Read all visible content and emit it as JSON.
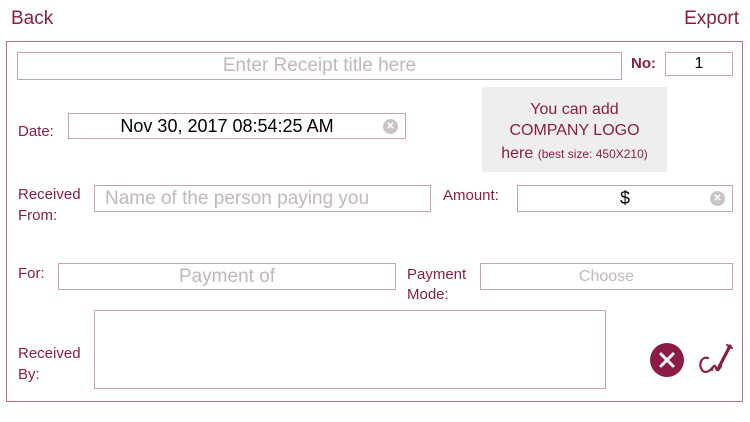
{
  "nav": {
    "back": "Back",
    "export": "Export"
  },
  "receipt": {
    "title_placeholder": "Enter Receipt title here",
    "no_label": "No:",
    "no_value": "1",
    "date_label": "Date:",
    "date_value": "Nov 30, 2017 08:54:25 AM",
    "logo": {
      "line1": "You can add",
      "line2": "COMPANY LOGO",
      "line3": "here",
      "line3_note": "(best size: 450X210)"
    },
    "received_from_label_1": "Received",
    "received_from_label_2": "From:",
    "received_from_placeholder": "Name of the person paying you",
    "amount_label": "Amount:",
    "amount_value": "$",
    "for_label": "For:",
    "for_placeholder": "Payment of",
    "payment_mode_label_1": "Payment",
    "payment_mode_label_2": "Mode:",
    "payment_mode_placeholder": "Choose",
    "received_by_label_1": "Received",
    "received_by_label_2": "By:"
  },
  "icons": {
    "clear": "clear-icon",
    "cancel": "cancel-icon",
    "signature": "signature-pen-icon"
  },
  "colors": {
    "accent": "#8a1d45",
    "border": "#c8a2b1",
    "placeholder": "#c0b7ba",
    "logo_bg": "#eeeeee"
  }
}
